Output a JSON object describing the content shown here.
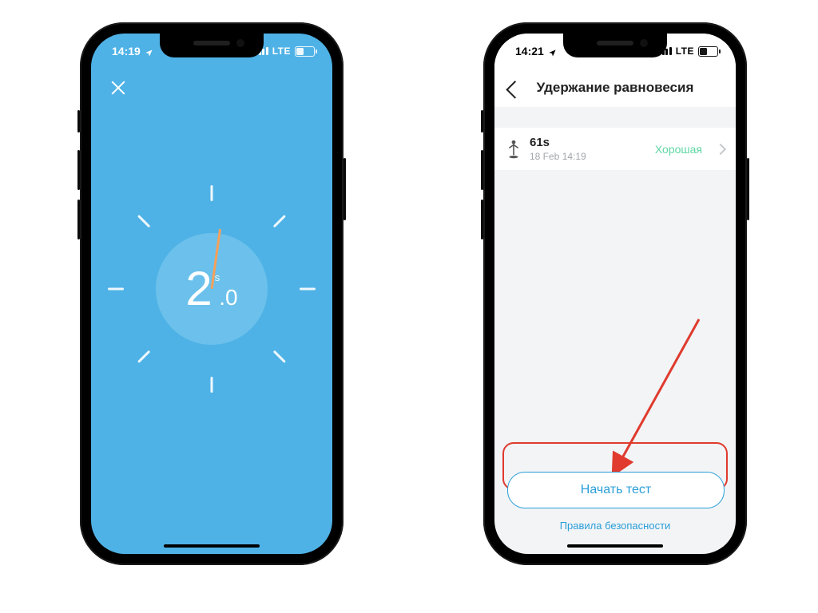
{
  "left": {
    "status": {
      "time": "14:19",
      "net": "LTE"
    },
    "timer": {
      "whole": "2",
      "fraction": ".0",
      "unit": "s"
    }
  },
  "right": {
    "status": {
      "time": "14:21",
      "net": "LTE"
    },
    "nav": {
      "title": "Удержание равновесия"
    },
    "record": {
      "value": "61s",
      "date": "18 Feb 14:19",
      "rating": "Хорошая"
    },
    "actions": {
      "start": "Начать тест",
      "safety": "Правила безопасности"
    }
  },
  "colors": {
    "timer_bg": "#4fb2e6",
    "timer_inner": "#6bc1eb",
    "needle": "#f5a05a",
    "accent": "#2a9ed8",
    "good": "#5ed7a3",
    "highlight": "#e03b2e"
  }
}
